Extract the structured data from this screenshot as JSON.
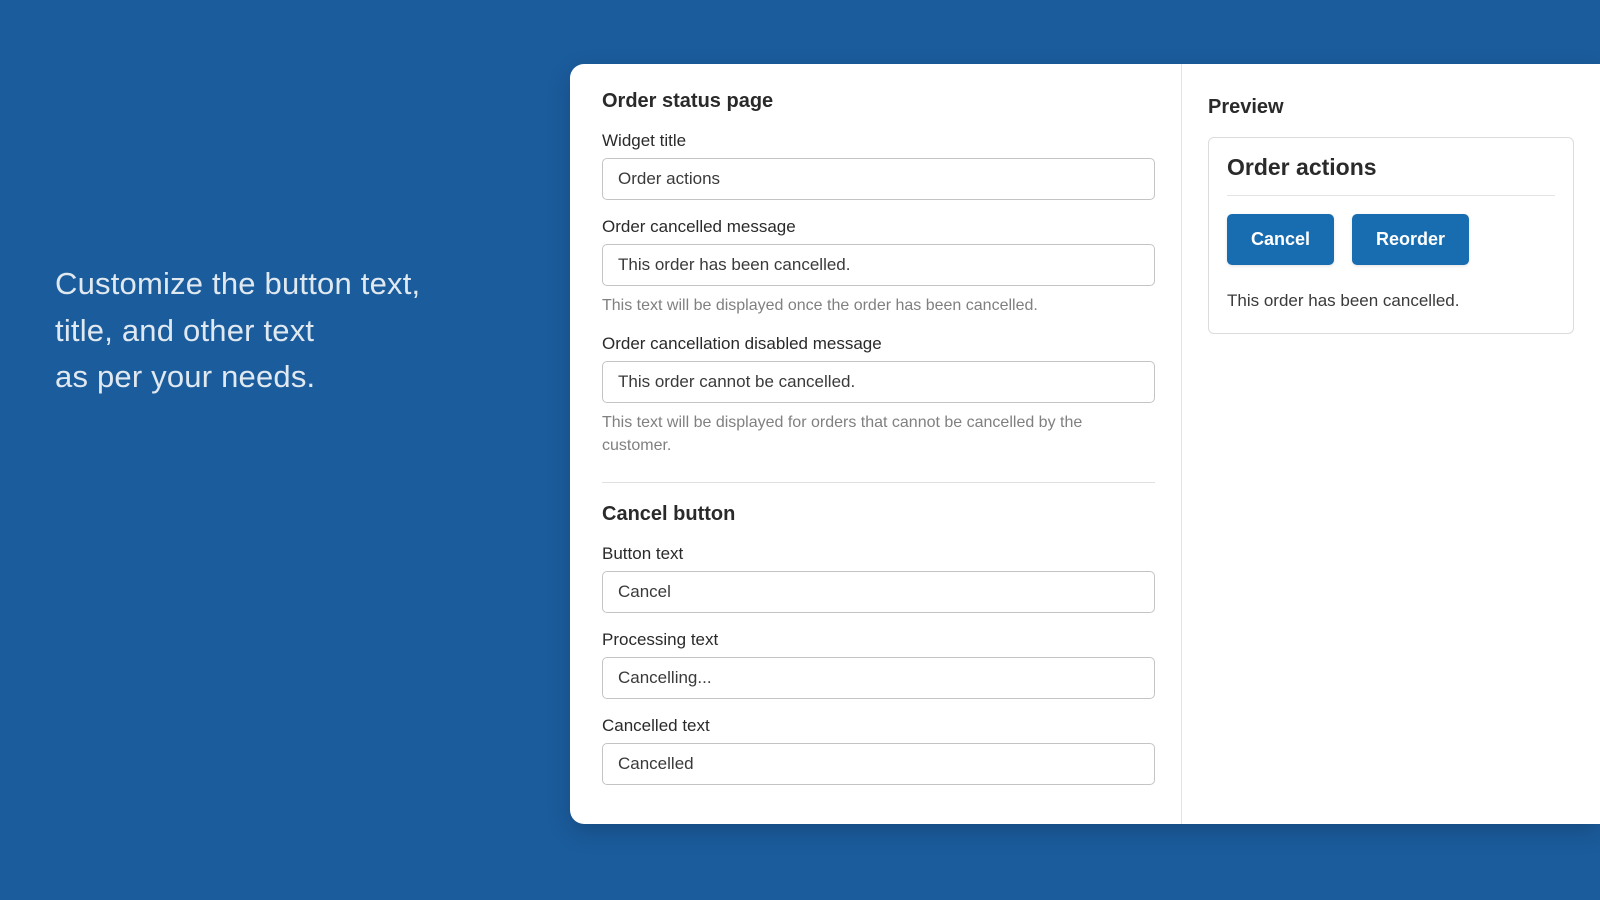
{
  "hero": {
    "line1": "Customize the button text,",
    "line2": "title, and other text",
    "line3": "as per your needs."
  },
  "form": {
    "section1_heading": "Order status page",
    "widget_title_label": "Widget title",
    "widget_title_value": "Order actions",
    "cancelled_message_label": "Order cancelled message",
    "cancelled_message_value": "This order has been cancelled.",
    "cancelled_message_help": "This text will be displayed once the order has been cancelled.",
    "disabled_message_label": "Order cancellation disabled message",
    "disabled_message_value": "This order cannot be cancelled.",
    "disabled_message_help": "This text will be displayed for orders that cannot be cancelled by the customer.",
    "section2_heading": "Cancel button",
    "button_text_label": "Button text",
    "button_text_value": "Cancel",
    "processing_text_label": "Processing text",
    "processing_text_value": "Cancelling...",
    "cancelled_text_label": "Cancelled text",
    "cancelled_text_value": "Cancelled"
  },
  "preview": {
    "heading": "Preview",
    "title": "Order actions",
    "btn_cancel": "Cancel",
    "btn_reorder": "Reorder",
    "message": "This order has been cancelled."
  }
}
